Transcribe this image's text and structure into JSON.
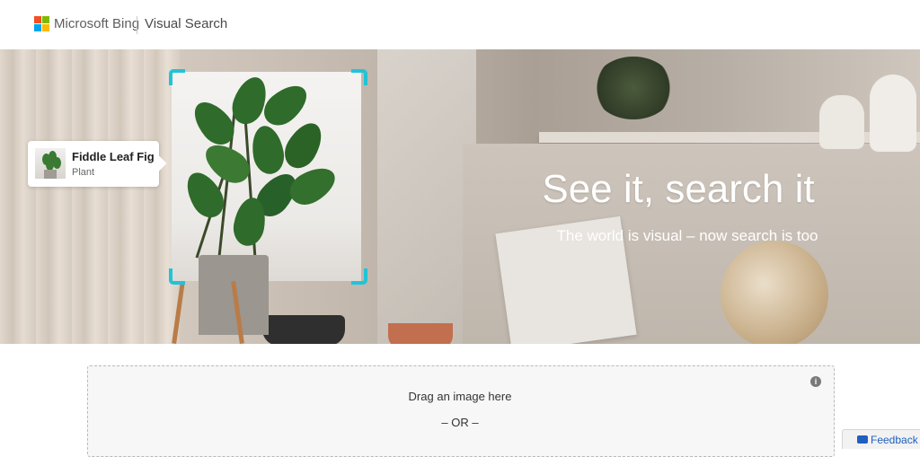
{
  "header": {
    "brand": "Microsoft Bing",
    "section": "Visual Search",
    "logo_colors": [
      "#f25022",
      "#7fba00",
      "#00a4ef",
      "#ffb900"
    ]
  },
  "hero": {
    "title": "See it, search it",
    "subtitle": "The world is visual – now search is too",
    "selection_color": "#22c3d6"
  },
  "result_card": {
    "title": "Fiddle Leaf Fig",
    "category": "Plant"
  },
  "upload": {
    "drag_text": "Drag an image here",
    "or_text": "– OR –",
    "info_icon": "i"
  },
  "feedback": {
    "label": "Feedback",
    "icon": "chat-icon"
  }
}
